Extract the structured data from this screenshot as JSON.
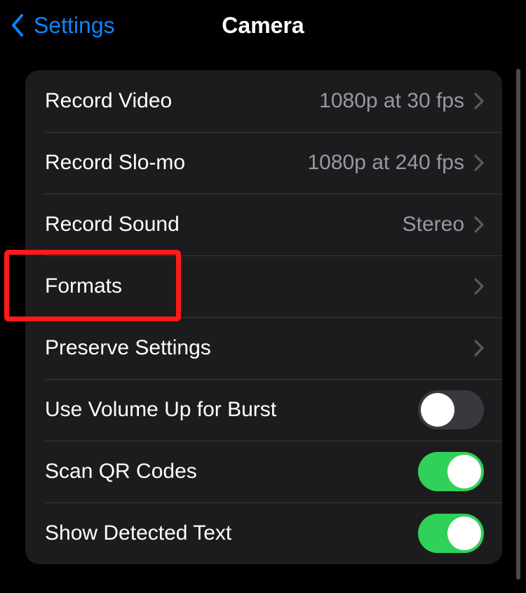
{
  "nav": {
    "back_label": "Settings",
    "title": "Camera"
  },
  "rows": {
    "record_video": {
      "label": "Record Video",
      "value": "1080p at 30 fps"
    },
    "record_slomo": {
      "label": "Record Slo-mo",
      "value": "1080p at 240 fps"
    },
    "record_sound": {
      "label": "Record Sound",
      "value": "Stereo"
    },
    "formats": {
      "label": "Formats"
    },
    "preserve": {
      "label": "Preserve Settings"
    },
    "volume_burst": {
      "label": "Use Volume Up for Burst",
      "on": false
    },
    "scan_qr": {
      "label": "Scan QR Codes",
      "on": true
    },
    "detected_text": {
      "label": "Show Detected Text",
      "on": true
    }
  },
  "highlight": {
    "target": "formats"
  },
  "colors": {
    "accent": "#0a84ff",
    "toggle_on": "#30d158",
    "toggle_off": "#39393d",
    "panel_bg": "#1c1c1e",
    "highlight_border": "#ff1a1a"
  }
}
